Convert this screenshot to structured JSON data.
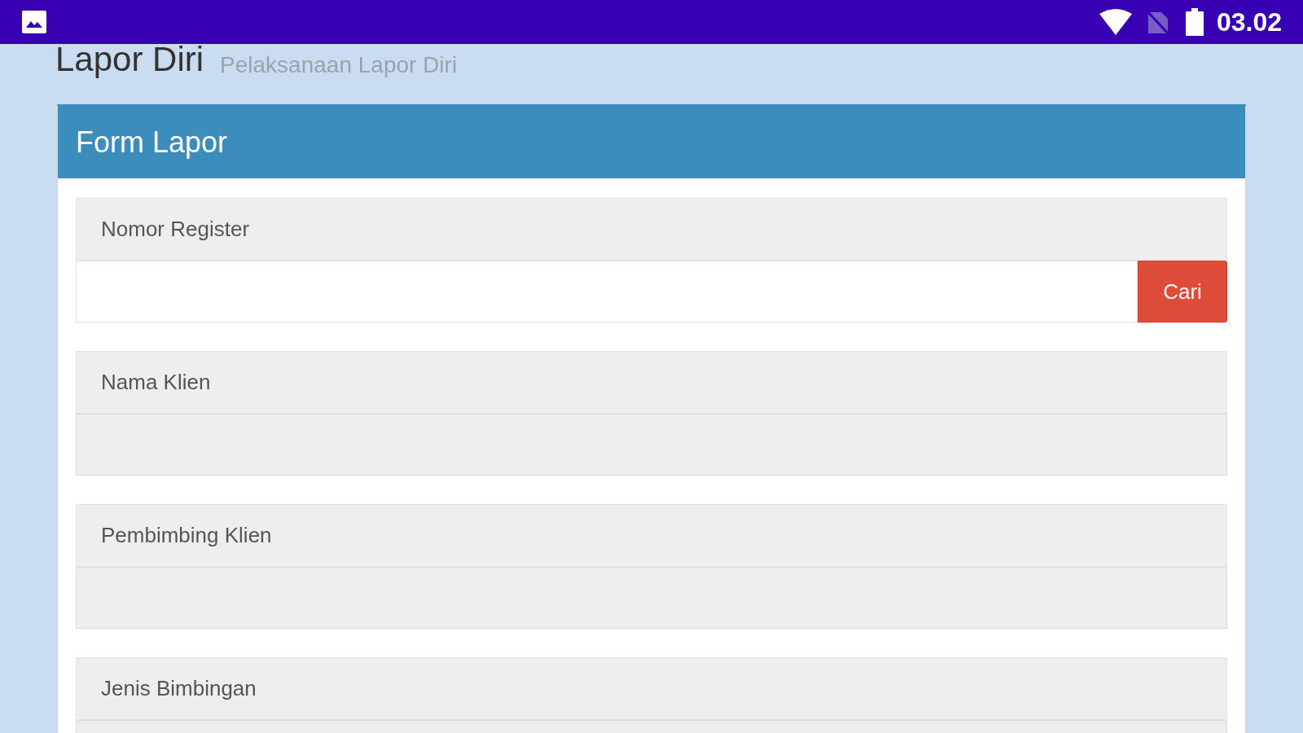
{
  "status_bar": {
    "time": "03.02"
  },
  "page": {
    "title": "Lapor Diri",
    "subtitle": "Pelaksanaan Lapor Diri"
  },
  "card": {
    "title": "Form Lapor",
    "fields": [
      {
        "label": "Nomor Register",
        "kind": "search",
        "button": "Cari"
      },
      {
        "label": "Nama Klien",
        "kind": "readonly"
      },
      {
        "label": "Pembimbing Klien",
        "kind": "readonly"
      },
      {
        "label": "Jenis Bimbingan",
        "kind": "readonly"
      }
    ]
  }
}
